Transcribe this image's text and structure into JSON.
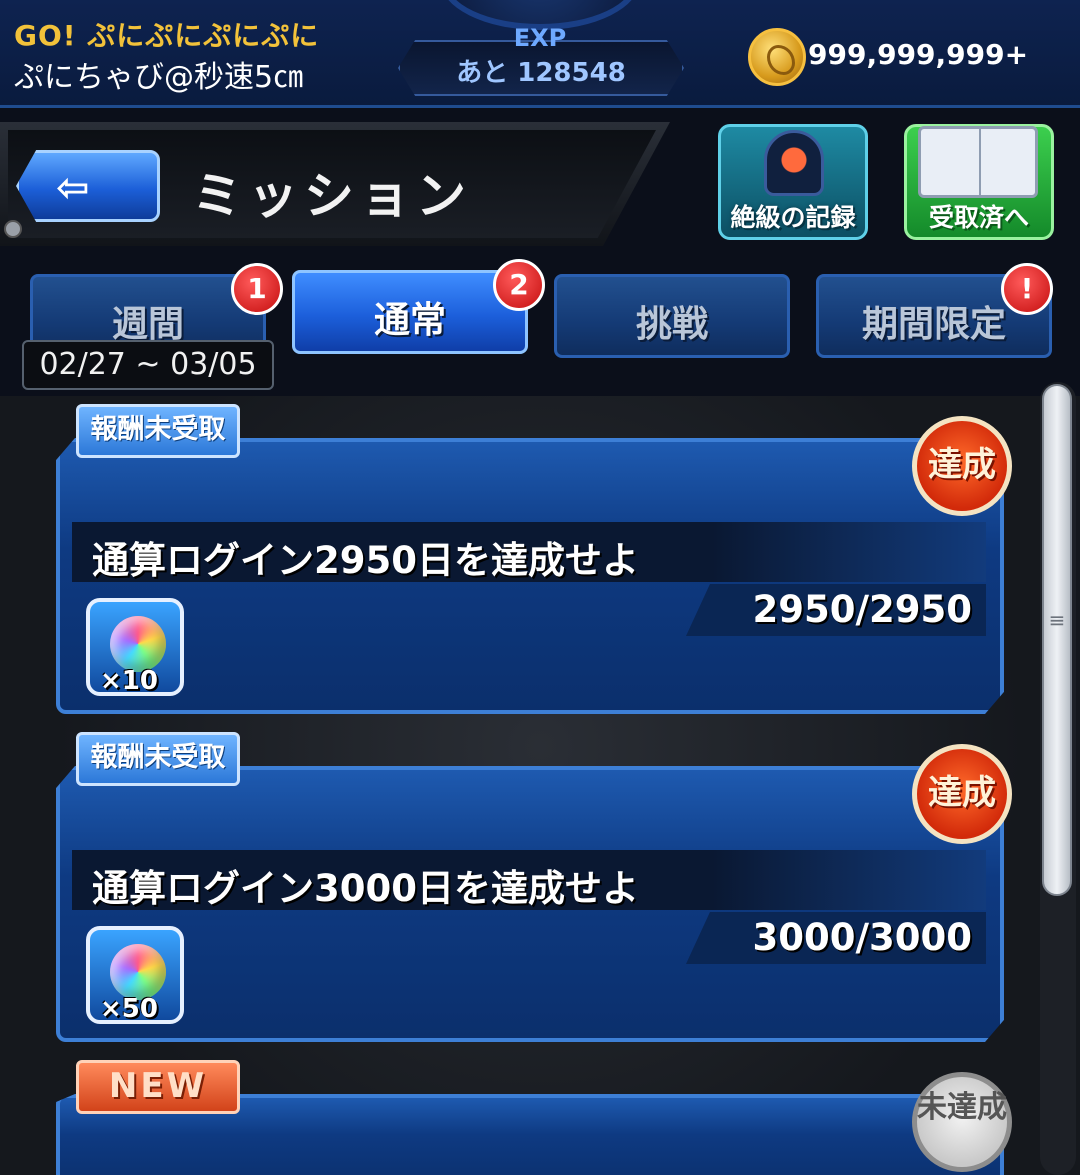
{
  "topbar": {
    "game_title": "GO! ぷにぷにぷにぷに",
    "player_name": "ぷにちゃび@秒速5㎝",
    "exp_label": "EXP",
    "exp_remaining": "あと 128548",
    "coins": "999,999,999+"
  },
  "header": {
    "title": "ミッション",
    "record_button_label": "絶級の記録",
    "received_button_label": "受取済へ"
  },
  "tabs": [
    {
      "label": "週間",
      "badge": "1",
      "active": false
    },
    {
      "label": "通常",
      "badge": "2",
      "active": true
    },
    {
      "label": "挑戦",
      "badge": "",
      "active": false
    },
    {
      "label": "期間限定",
      "badge": "!",
      "active": false
    }
  ],
  "weekly_date_range": "02/27 ~ 03/05",
  "missions": [
    {
      "tag": "報酬未受取",
      "stamp": "達成",
      "title": "通算ログイン2950日を達成せよ",
      "progress": "2950/2950",
      "reward_qty": "×10"
    },
    {
      "tag": "報酬未受取",
      "stamp": "達成",
      "title": "通算ログイン3000日を達成せよ",
      "progress": "3000/3000",
      "reward_qty": "×50"
    },
    {
      "tag": "NEW",
      "stamp": "未達成"
    }
  ],
  "colors": {
    "accent_blue": "#1c5fdb",
    "gold_text": "#f2c23a",
    "badge_red": "#c40e0e",
    "new_orange": "#d2431a"
  }
}
